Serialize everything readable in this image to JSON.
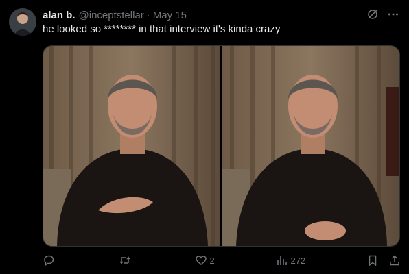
{
  "tweet": {
    "author_name": "alan b.",
    "handle": "@inceptstellar",
    "separator": "·",
    "date": "May 15",
    "text": "he looked so ******** in that interview it's kinda crazy"
  },
  "actions": {
    "replies": "",
    "retweets": "",
    "likes": "2",
    "views": "272"
  },
  "colors": {
    "background": "#000000",
    "text": "#e7e9ea",
    "muted": "#71767b"
  },
  "icons": [
    "grok-icon",
    "more-icon",
    "reply-icon",
    "retweet-icon",
    "like-icon",
    "views-icon",
    "bookmark-icon",
    "share-icon"
  ]
}
